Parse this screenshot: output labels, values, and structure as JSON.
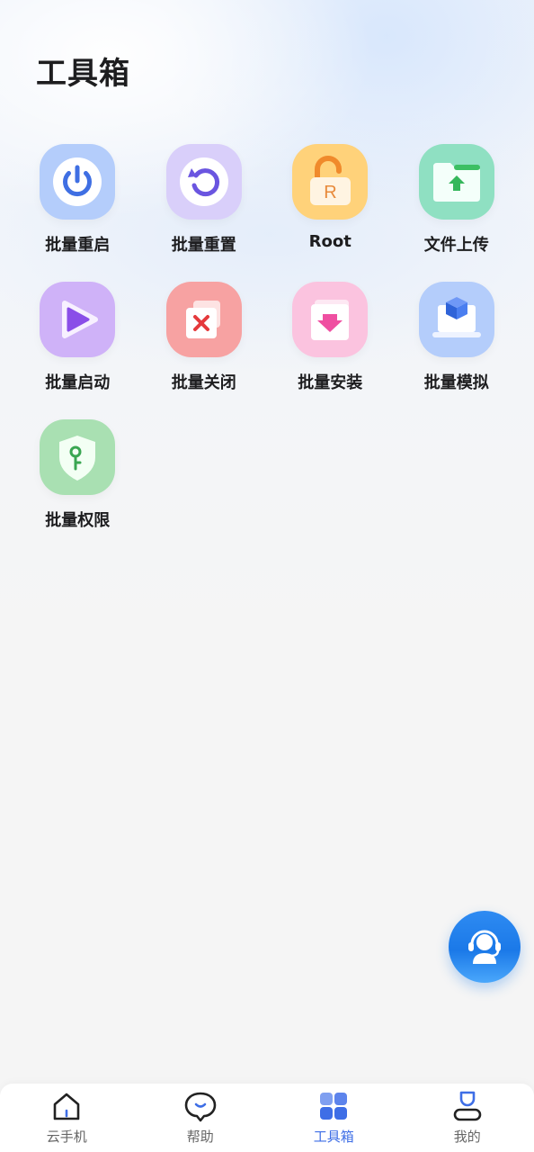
{
  "page": {
    "title": "工具箱"
  },
  "tools": [
    {
      "label": "批量重启",
      "icon": "power-icon"
    },
    {
      "label": "批量重置",
      "icon": "reset-icon"
    },
    {
      "label": "Root",
      "icon": "unlock-icon"
    },
    {
      "label": "文件上传",
      "icon": "folder-upload-icon"
    },
    {
      "label": "批量启动",
      "icon": "play-icon"
    },
    {
      "label": "批量关闭",
      "icon": "close-window-icon"
    },
    {
      "label": "批量安装",
      "icon": "install-icon"
    },
    {
      "label": "批量模拟",
      "icon": "cube-laptop-icon"
    },
    {
      "label": "批量权限",
      "icon": "shield-key-icon"
    }
  ],
  "support": {
    "icon": "customer-service-icon"
  },
  "nav": {
    "items": [
      {
        "label": "云手机",
        "icon": "home-icon",
        "active": false
      },
      {
        "label": "帮助",
        "icon": "chat-bubble-icon",
        "active": false
      },
      {
        "label": "工具箱",
        "icon": "grid-icon",
        "active": true
      },
      {
        "label": "我的",
        "icon": "user-icon",
        "active": false
      }
    ]
  },
  "colors": {
    "accent": "#3e6ee6",
    "fab": "#1b79e8",
    "title": "#1d1d1f",
    "nav_inactive": "#666666"
  }
}
